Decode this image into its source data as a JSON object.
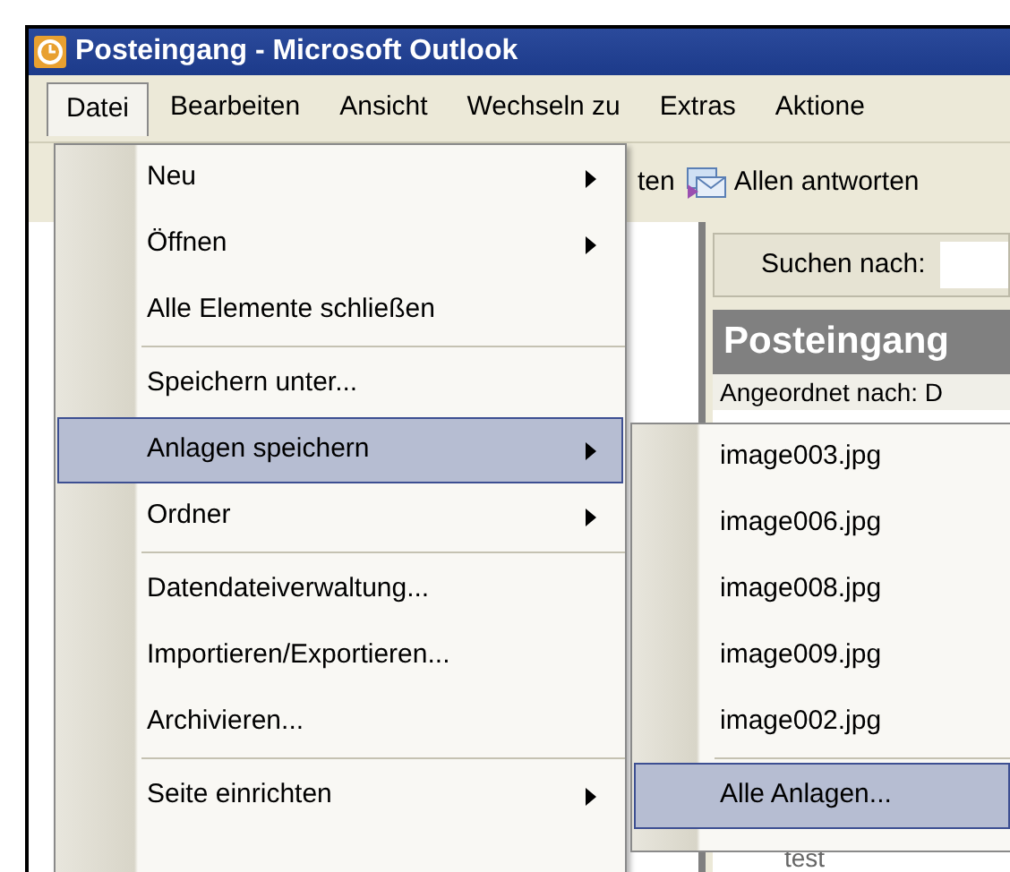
{
  "window": {
    "title": "Posteingang - Microsoft Outlook"
  },
  "menu_bar": [
    {
      "label": "Datei",
      "selected": true
    },
    {
      "label": "Bearbeiten",
      "selected": false
    },
    {
      "label": "Ansicht",
      "selected": false
    },
    {
      "label": "Wechseln zu",
      "selected": false
    },
    {
      "label": "Extras",
      "selected": false
    },
    {
      "label": "Aktione",
      "selected": false
    }
  ],
  "toolbar": [
    {
      "label": "ten",
      "kind": "text"
    },
    {
      "label": "Allen antworten",
      "kind": "reply-all"
    }
  ],
  "search": {
    "label": "Suchen nach:"
  },
  "folder": {
    "title": "Posteingang",
    "sort_label": "Angeordnet nach: D",
    "message": "test"
  },
  "file_menu": [
    {
      "kind": "item",
      "label": "Neu",
      "submenu": true,
      "selected": false
    },
    {
      "kind": "item",
      "label": "Öffnen",
      "submenu": true,
      "selected": false
    },
    {
      "kind": "item",
      "label": "Alle Elemente schließen",
      "submenu": false,
      "selected": false
    },
    {
      "kind": "separator"
    },
    {
      "kind": "item",
      "label": "Speichern unter...",
      "submenu": false,
      "selected": false
    },
    {
      "kind": "item",
      "label": "Anlagen speichern",
      "submenu": true,
      "selected": true
    },
    {
      "kind": "item",
      "label": "Ordner",
      "submenu": true,
      "selected": false
    },
    {
      "kind": "separator"
    },
    {
      "kind": "item",
      "label": "Datendateiverwaltung...",
      "submenu": false,
      "selected": false
    },
    {
      "kind": "item",
      "label": "Importieren/Exportieren...",
      "submenu": false,
      "selected": false
    },
    {
      "kind": "item",
      "label": "Archivieren...",
      "submenu": false,
      "selected": false
    },
    {
      "kind": "separator"
    },
    {
      "kind": "item",
      "label": "Seite einrichten",
      "submenu": true,
      "selected": false
    }
  ],
  "attachments_menu": [
    {
      "kind": "item",
      "label": "image003.jpg",
      "selected": false
    },
    {
      "kind": "item",
      "label": "image006.jpg",
      "selected": false
    },
    {
      "kind": "item",
      "label": "image008.jpg",
      "selected": false
    },
    {
      "kind": "item",
      "label": "image009.jpg",
      "selected": false
    },
    {
      "kind": "item",
      "label": "image002.jpg",
      "selected": false
    },
    {
      "kind": "separator"
    },
    {
      "kind": "item",
      "label": "Alle Anlagen...",
      "selected": true
    }
  ]
}
